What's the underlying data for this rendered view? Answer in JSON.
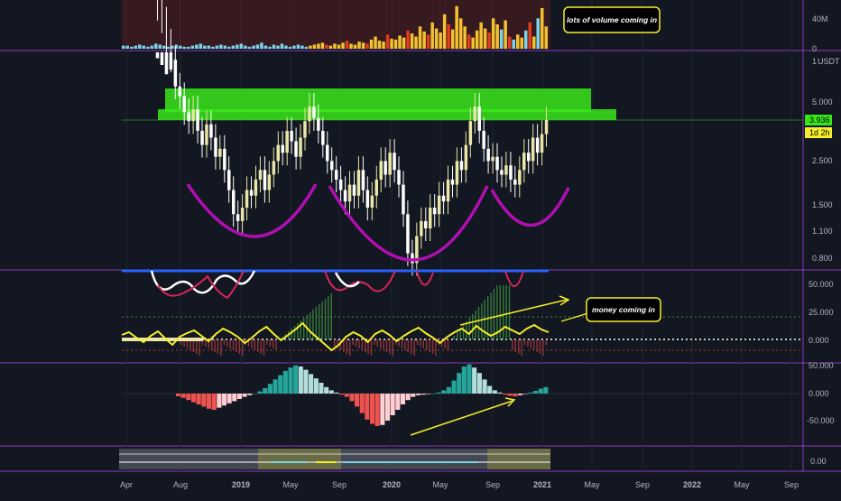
{
  "colors": {
    "background": "#131722",
    "pane_border": "#8a3bbf",
    "grid": "#1f2433",
    "axis_text": "#b2b5be",
    "green_zone": "#39e61a",
    "purple_arc": "#b00fb0",
    "annotation": "#f4ef2a",
    "candle_up": "#e9e6a6",
    "candle_down": "#ffffff",
    "vol_blue": "#7fd3e8",
    "vol_yellow": "#f2c230",
    "vol_red": "#e23b1f",
    "hist_green": "#3c8c3c",
    "hist_red": "#a63a3a",
    "macd_teal": "#26a69a",
    "macd_light": "#b2dfdb",
    "macd_red": "#ef5350",
    "macd_pink": "#ffcdd2"
  },
  "annotations": {
    "volume": "lots of volume coming in",
    "money": "money coming in"
  },
  "price_axis": {
    "unit": "USDT",
    "current_price": "3.936",
    "countdown": "1d 2h"
  },
  "chart_data": [
    {
      "type": "bar",
      "pane": "volume",
      "y_ticks": [
        "40M",
        "0"
      ],
      "values_m": [
        3,
        3,
        2,
        3,
        4,
        3,
        2,
        3,
        5,
        4,
        3,
        2,
        3,
        4,
        3,
        2,
        2,
        3,
        4,
        5,
        3,
        3,
        2,
        3,
        4,
        3,
        2,
        3,
        4,
        5,
        3,
        2,
        3,
        4,
        6,
        3,
        2,
        4,
        3,
        5,
        3,
        2,
        3,
        4,
        3,
        2,
        3,
        4,
        5,
        6,
        4,
        3,
        5,
        4,
        6,
        8,
        5,
        4,
        7,
        6,
        5,
        9,
        12,
        8,
        7,
        14,
        10,
        9,
        13,
        11,
        18,
        15,
        12,
        22,
        17,
        14,
        26,
        20,
        16,
        34,
        24,
        19,
        42,
        30,
        22,
        14,
        11,
        18,
        26,
        20,
        16,
        30,
        24,
        19,
        28,
        12,
        9,
        14,
        11,
        18,
        26,
        12,
        30,
        40,
        22
      ]
    },
    {
      "type": "candlestick",
      "pane": "price",
      "y_scale": "log",
      "y_ticks": [
        "1",
        "5.000",
        "2.500",
        "1.500",
        "1.100",
        "0.800"
      ],
      "x_ticks": [
        "Apr",
        "Aug",
        "2019",
        "May",
        "Sep",
        "2020",
        "May",
        "Sep",
        "2021",
        "May",
        "Sep",
        "2022",
        "May",
        "Sep"
      ],
      "closes": [
        10,
        9,
        7.5,
        6.5,
        5.2,
        4.8,
        4.2,
        3.9,
        4.3,
        3.6,
        3.2,
        3.8,
        3.4,
        2.9,
        3.1,
        2.6,
        2.2,
        1.8,
        1.7,
        1.9,
        2.2,
        2.1,
        2.4,
        2.6,
        2.2,
        2.5,
        2.8,
        3.2,
        3.0,
        3.6,
        3.3,
        2.9,
        3.4,
        3.9,
        4.4,
        4.0,
        3.6,
        3.2,
        2.8,
        2.6,
        2.4,
        2.2,
        2.0,
        2.3,
        2.1,
        2.6,
        2.2,
        1.9,
        2.1,
        2.4,
        2.8,
        2.5,
        3.0,
        2.6,
        2.3,
        1.8,
        1.3,
        1.2,
        1.5,
        1.7,
        1.6,
        1.9,
        1.8,
        2.1,
        2.0,
        2.4,
        2.3,
        2.8,
        2.6,
        3.2,
        3.9,
        4.4,
        3.6,
        3.1,
        2.8,
        2.9,
        2.6,
        2.5,
        2.7,
        2.4,
        2.3,
        2.6,
        3.0,
        2.8,
        3.4,
        3.0,
        3.5,
        3.936
      ],
      "key_level": 3.936,
      "resistance_zone": [
        3.8,
        5.6
      ],
      "pattern": "inverse head and shoulders"
    },
    {
      "type": "line",
      "pane": "money_flow",
      "y_ticks": [
        "50.000",
        "25.000",
        "0.000"
      ],
      "series": [
        {
          "values": [
            5,
            8,
            2,
            -3,
            4,
            9,
            1,
            -6,
            3,
            7,
            10,
            4,
            -2,
            6,
            12,
            8,
            3,
            -4,
            2,
            9,
            14,
            6,
            -1,
            5,
            11,
            18,
            9,
            2,
            -5,
            -12,
            -6,
            3,
            8,
            4,
            -3,
            6,
            10,
            5,
            -2,
            4,
            9,
            13,
            7,
            2,
            -4,
            3,
            8,
            12,
            6,
            15,
            9,
            4,
            8,
            14,
            10,
            6,
            12,
            16,
            11,
            8
          ]
        }
      ]
    },
    {
      "type": "bar",
      "pane": "macd",
      "y_ticks": [
        "50.000",
        "0.000",
        "-50.000"
      ],
      "values": [
        -5,
        -8,
        -12,
        -16,
        -20,
        -24,
        -28,
        -30,
        -26,
        -22,
        -18,
        -14,
        -10,
        -6,
        -3,
        0,
        4,
        10,
        18,
        26,
        34,
        42,
        48,
        52,
        50,
        44,
        36,
        28,
        20,
        12,
        6,
        2,
        -2,
        -6,
        -14,
        -24,
        -36,
        -48,
        -56,
        -60,
        -58,
        -50,
        -40,
        -30,
        -20,
        -12,
        -6,
        -3,
        -2,
        -1,
        0,
        2,
        6,
        12,
        24,
        38,
        50,
        54,
        48,
        38,
        26,
        14,
        6,
        2,
        -2,
        -4,
        -5,
        -3,
        -1,
        2,
        5,
        9,
        12
      ]
    },
    {
      "type": "line",
      "pane": "oscillator",
      "y_ticks": [
        "0.00"
      ]
    }
  ]
}
